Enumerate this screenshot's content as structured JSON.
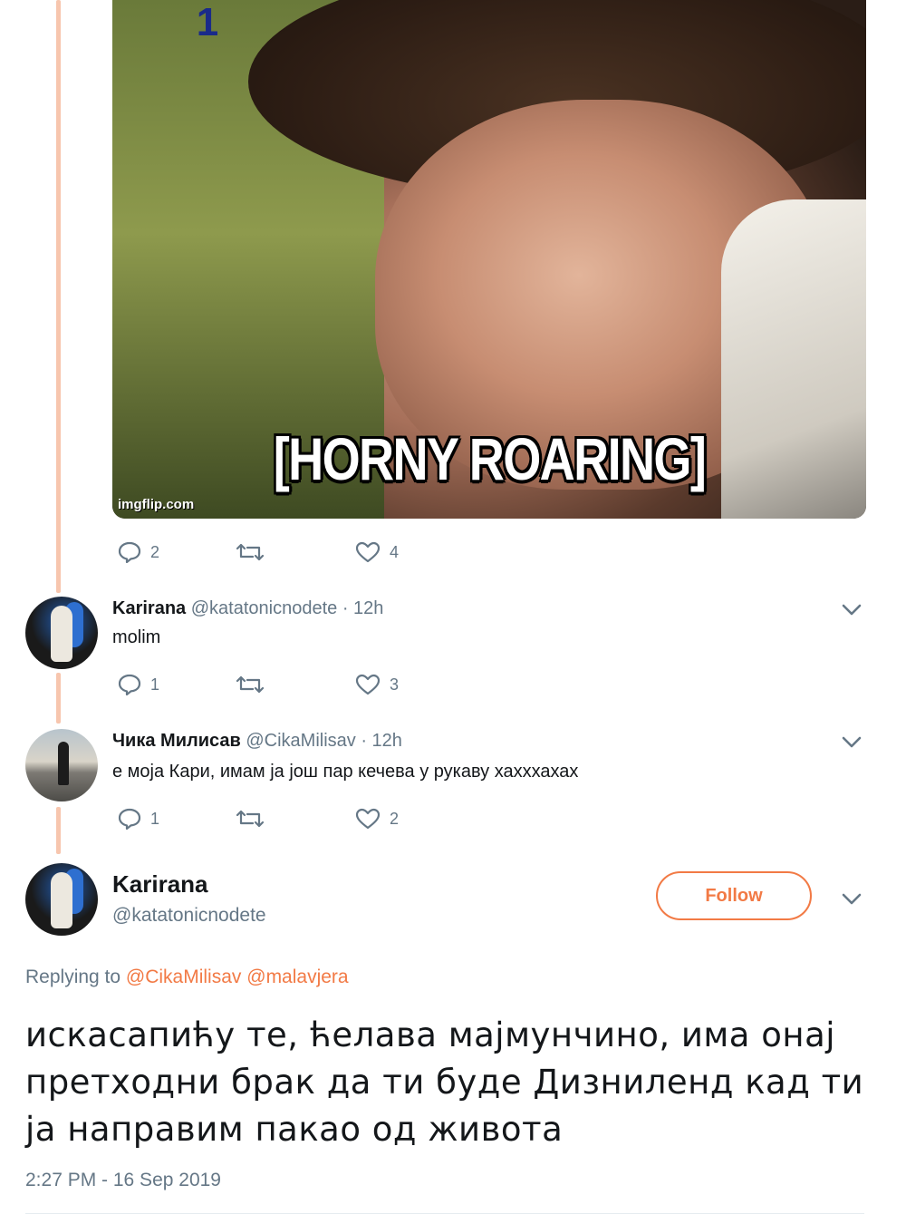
{
  "media": {
    "caption": "[HORNY ROARING]",
    "watermark": "imgflip.com",
    "channel_logo": "1"
  },
  "parent_tweet_actions": {
    "replies": "2",
    "retweets": "",
    "likes": "4"
  },
  "replies": [
    {
      "display_name": "Karirana",
      "handle": "@katatonicnodete",
      "time": "· 12h",
      "text": "molim",
      "counts": {
        "replies": "1",
        "retweets": "",
        "likes": "3"
      }
    },
    {
      "display_name": "Чика Милисав",
      "handle": "@CikaMilisav",
      "time": "· 12h",
      "text": "е моја Кари, имам ја још пар кечева у рукаву хахххахах",
      "counts": {
        "replies": "1",
        "retweets": "",
        "likes": "2"
      }
    }
  ],
  "main_tweet": {
    "display_name": "Karirana",
    "handle": "@katatonicnodete",
    "follow_label": "Follow",
    "replying_prefix": "Replying to",
    "mentions": [
      "@CikaMilisav",
      "@malavjera"
    ],
    "text": "искасапићу те, ћелава мајмунчино, има онај претходни брак да ти буде Дизниленд кад ти ја направим пакао од живота",
    "timestamp": "2:27 PM - 16 Sep 2019"
  },
  "colors": {
    "accent": "#f27a45",
    "thread_line": "#f7c6ae",
    "muted": "#657786"
  },
  "icons": [
    "reply-icon",
    "retweet-icon",
    "like-icon",
    "chevron-down-icon"
  ]
}
